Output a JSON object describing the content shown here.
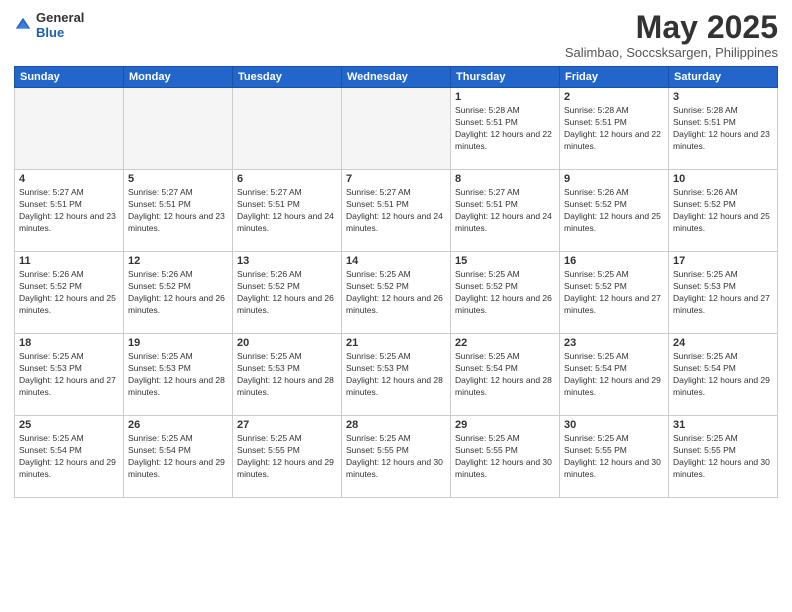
{
  "header": {
    "logo_general": "General",
    "logo_blue": "Blue",
    "month_title": "May 2025",
    "location": "Salimbao, Soccsksargen, Philippines"
  },
  "weekdays": [
    "Sunday",
    "Monday",
    "Tuesday",
    "Wednesday",
    "Thursday",
    "Friday",
    "Saturday"
  ],
  "weeks": [
    [
      {
        "day": "",
        "sunrise": "",
        "sunset": "",
        "daylight": ""
      },
      {
        "day": "",
        "sunrise": "",
        "sunset": "",
        "daylight": ""
      },
      {
        "day": "",
        "sunrise": "",
        "sunset": "",
        "daylight": ""
      },
      {
        "day": "",
        "sunrise": "",
        "sunset": "",
        "daylight": ""
      },
      {
        "day": "1",
        "sunrise": "Sunrise: 5:28 AM",
        "sunset": "Sunset: 5:51 PM",
        "daylight": "Daylight: 12 hours and 22 minutes."
      },
      {
        "day": "2",
        "sunrise": "Sunrise: 5:28 AM",
        "sunset": "Sunset: 5:51 PM",
        "daylight": "Daylight: 12 hours and 22 minutes."
      },
      {
        "day": "3",
        "sunrise": "Sunrise: 5:28 AM",
        "sunset": "Sunset: 5:51 PM",
        "daylight": "Daylight: 12 hours and 23 minutes."
      }
    ],
    [
      {
        "day": "4",
        "sunrise": "Sunrise: 5:27 AM",
        "sunset": "Sunset: 5:51 PM",
        "daylight": "Daylight: 12 hours and 23 minutes."
      },
      {
        "day": "5",
        "sunrise": "Sunrise: 5:27 AM",
        "sunset": "Sunset: 5:51 PM",
        "daylight": "Daylight: 12 hours and 23 minutes."
      },
      {
        "day": "6",
        "sunrise": "Sunrise: 5:27 AM",
        "sunset": "Sunset: 5:51 PM",
        "daylight": "Daylight: 12 hours and 24 minutes."
      },
      {
        "day": "7",
        "sunrise": "Sunrise: 5:27 AM",
        "sunset": "Sunset: 5:51 PM",
        "daylight": "Daylight: 12 hours and 24 minutes."
      },
      {
        "day": "8",
        "sunrise": "Sunrise: 5:27 AM",
        "sunset": "Sunset: 5:51 PM",
        "daylight": "Daylight: 12 hours and 24 minutes."
      },
      {
        "day": "9",
        "sunrise": "Sunrise: 5:26 AM",
        "sunset": "Sunset: 5:52 PM",
        "daylight": "Daylight: 12 hours and 25 minutes."
      },
      {
        "day": "10",
        "sunrise": "Sunrise: 5:26 AM",
        "sunset": "Sunset: 5:52 PM",
        "daylight": "Daylight: 12 hours and 25 minutes."
      }
    ],
    [
      {
        "day": "11",
        "sunrise": "Sunrise: 5:26 AM",
        "sunset": "Sunset: 5:52 PM",
        "daylight": "Daylight: 12 hours and 25 minutes."
      },
      {
        "day": "12",
        "sunrise": "Sunrise: 5:26 AM",
        "sunset": "Sunset: 5:52 PM",
        "daylight": "Daylight: 12 hours and 26 minutes."
      },
      {
        "day": "13",
        "sunrise": "Sunrise: 5:26 AM",
        "sunset": "Sunset: 5:52 PM",
        "daylight": "Daylight: 12 hours and 26 minutes."
      },
      {
        "day": "14",
        "sunrise": "Sunrise: 5:25 AM",
        "sunset": "Sunset: 5:52 PM",
        "daylight": "Daylight: 12 hours and 26 minutes."
      },
      {
        "day": "15",
        "sunrise": "Sunrise: 5:25 AM",
        "sunset": "Sunset: 5:52 PM",
        "daylight": "Daylight: 12 hours and 26 minutes."
      },
      {
        "day": "16",
        "sunrise": "Sunrise: 5:25 AM",
        "sunset": "Sunset: 5:52 PM",
        "daylight": "Daylight: 12 hours and 27 minutes."
      },
      {
        "day": "17",
        "sunrise": "Sunrise: 5:25 AM",
        "sunset": "Sunset: 5:53 PM",
        "daylight": "Daylight: 12 hours and 27 minutes."
      }
    ],
    [
      {
        "day": "18",
        "sunrise": "Sunrise: 5:25 AM",
        "sunset": "Sunset: 5:53 PM",
        "daylight": "Daylight: 12 hours and 27 minutes."
      },
      {
        "day": "19",
        "sunrise": "Sunrise: 5:25 AM",
        "sunset": "Sunset: 5:53 PM",
        "daylight": "Daylight: 12 hours and 28 minutes."
      },
      {
        "day": "20",
        "sunrise": "Sunrise: 5:25 AM",
        "sunset": "Sunset: 5:53 PM",
        "daylight": "Daylight: 12 hours and 28 minutes."
      },
      {
        "day": "21",
        "sunrise": "Sunrise: 5:25 AM",
        "sunset": "Sunset: 5:53 PM",
        "daylight": "Daylight: 12 hours and 28 minutes."
      },
      {
        "day": "22",
        "sunrise": "Sunrise: 5:25 AM",
        "sunset": "Sunset: 5:54 PM",
        "daylight": "Daylight: 12 hours and 28 minutes."
      },
      {
        "day": "23",
        "sunrise": "Sunrise: 5:25 AM",
        "sunset": "Sunset: 5:54 PM",
        "daylight": "Daylight: 12 hours and 29 minutes."
      },
      {
        "day": "24",
        "sunrise": "Sunrise: 5:25 AM",
        "sunset": "Sunset: 5:54 PM",
        "daylight": "Daylight: 12 hours and 29 minutes."
      }
    ],
    [
      {
        "day": "25",
        "sunrise": "Sunrise: 5:25 AM",
        "sunset": "Sunset: 5:54 PM",
        "daylight": "Daylight: 12 hours and 29 minutes."
      },
      {
        "day": "26",
        "sunrise": "Sunrise: 5:25 AM",
        "sunset": "Sunset: 5:54 PM",
        "daylight": "Daylight: 12 hours and 29 minutes."
      },
      {
        "day": "27",
        "sunrise": "Sunrise: 5:25 AM",
        "sunset": "Sunset: 5:55 PM",
        "daylight": "Daylight: 12 hours and 29 minutes."
      },
      {
        "day": "28",
        "sunrise": "Sunrise: 5:25 AM",
        "sunset": "Sunset: 5:55 PM",
        "daylight": "Daylight: 12 hours and 30 minutes."
      },
      {
        "day": "29",
        "sunrise": "Sunrise: 5:25 AM",
        "sunset": "Sunset: 5:55 PM",
        "daylight": "Daylight: 12 hours and 30 minutes."
      },
      {
        "day": "30",
        "sunrise": "Sunrise: 5:25 AM",
        "sunset": "Sunset: 5:55 PM",
        "daylight": "Daylight: 12 hours and 30 minutes."
      },
      {
        "day": "31",
        "sunrise": "Sunrise: 5:25 AM",
        "sunset": "Sunset: 5:55 PM",
        "daylight": "Daylight: 12 hours and 30 minutes."
      }
    ]
  ]
}
